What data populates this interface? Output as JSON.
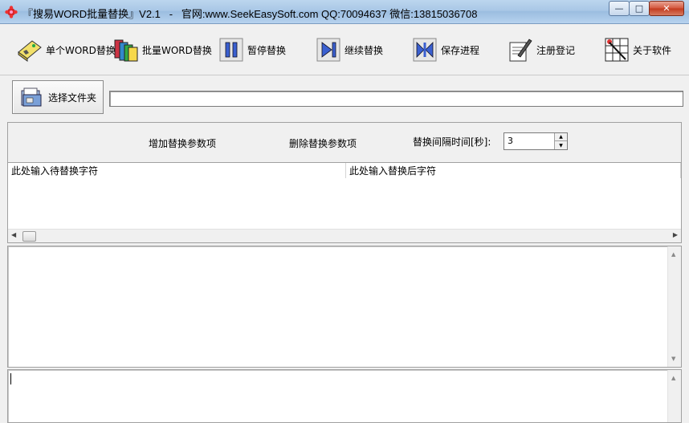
{
  "window": {
    "title": "『搜易WORD批量替换』V2.1   -   官网:www.SeekEasySoft.com QQ:70094637 微信:13815036708",
    "minimize": "—",
    "maximize": "□",
    "close": "✕"
  },
  "toolbar": {
    "single_replace": "单个WORD替换",
    "batch_replace": "批量WORD替换",
    "pause": "暂停替换",
    "resume": "继续替换",
    "save_progress": "保存进程",
    "register": "注册登记",
    "about": "关于软件"
  },
  "folder": {
    "select_button": "选择文件夹",
    "path_value": ""
  },
  "params": {
    "add_label": "增加替换参数项",
    "delete_label": "删除替换参数项",
    "interval_label": "替换间隔时间[秒]:",
    "interval_value": "3"
  },
  "grid": {
    "columns": [
      "此处输入待替换字符",
      "此处输入替换后字符"
    ]
  },
  "log": {
    "main_text": "",
    "bottom_text": ""
  }
}
